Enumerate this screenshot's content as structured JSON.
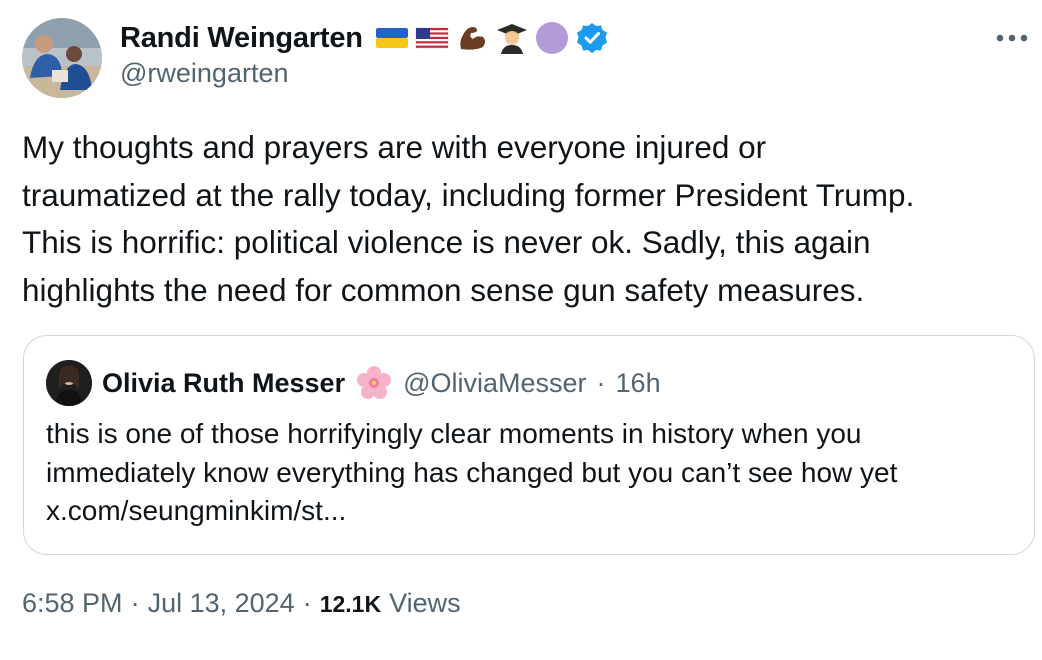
{
  "author": {
    "display_name": "Randi Weingarten",
    "handle": "@rweingarten",
    "badges": [
      "ukraine-flag-icon",
      "us-flag-icon",
      "flexed-biceps-icon",
      "graduate-icon",
      "purple-circle-icon",
      "verified-badge-icon"
    ]
  },
  "tweet": {
    "text_lines": [
      "My thoughts and prayers are with everyone injured or",
      "traumatized at the rally today, including former President Trump.",
      "This is horrific: political violence is never ok. Sadly, this again",
      "highlights the need for common sense gun safety measures."
    ]
  },
  "quoted_tweet": {
    "display_name": "Olivia Ruth Messer",
    "emoji": "cherry-blossom-icon",
    "handle": "@OliviaMesser",
    "separator": "·",
    "time": "16h",
    "text_lines": [
      "this is one of those horrifyingly clear moments in history when you",
      "immediately know everything has changed but you can’t see how yet",
      "x.com/seungminkim/st..."
    ]
  },
  "meta": {
    "time": "6:58 PM",
    "sep1": "·",
    "date": "Jul 13, 2024",
    "sep2": "·",
    "views_count": "12.1K",
    "views_label": "Views"
  },
  "colors": {
    "text": "#0f1419",
    "secondary": "#536471",
    "border": "#cfd9de",
    "verified": "#1d9bf0"
  }
}
